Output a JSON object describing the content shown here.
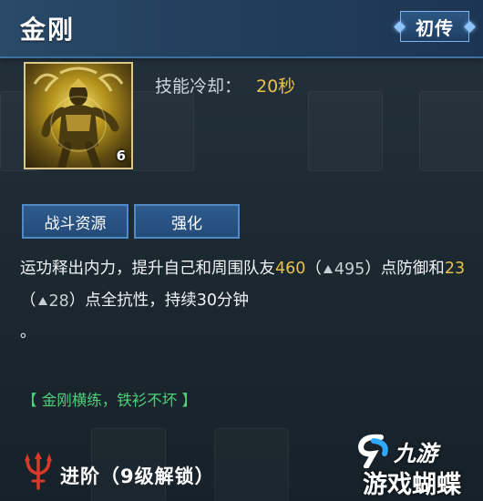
{
  "header": {
    "title": "金刚",
    "badge": "初传"
  },
  "skill": {
    "level": "6",
    "cooldown_label": "技能冷却：",
    "cooldown_value": "20秒"
  },
  "buttons": {
    "battle_resource": "战斗资源",
    "enhance": "强化"
  },
  "description": {
    "part1": "运功释出内力，提升自己和周围队友",
    "value1": "460",
    "paren_open1": "（",
    "next1": "495",
    "part2": "）点防御和",
    "value2": "23",
    "paren_open2": "（",
    "next2": "28",
    "part3": "）点全抗性，持续30分钟",
    "end": "。"
  },
  "motto": "【 金刚横练，铁衫不坏 】",
  "advance": {
    "label": "进阶",
    "lock": "（9级解锁）"
  },
  "watermark": {
    "top": "九游",
    "bottom": "游戏蝴蝶"
  },
  "colors": {
    "accent_gold": "#e8c24a",
    "motto_green": "#4fd07a",
    "header_blue": "#2a4a6a"
  }
}
